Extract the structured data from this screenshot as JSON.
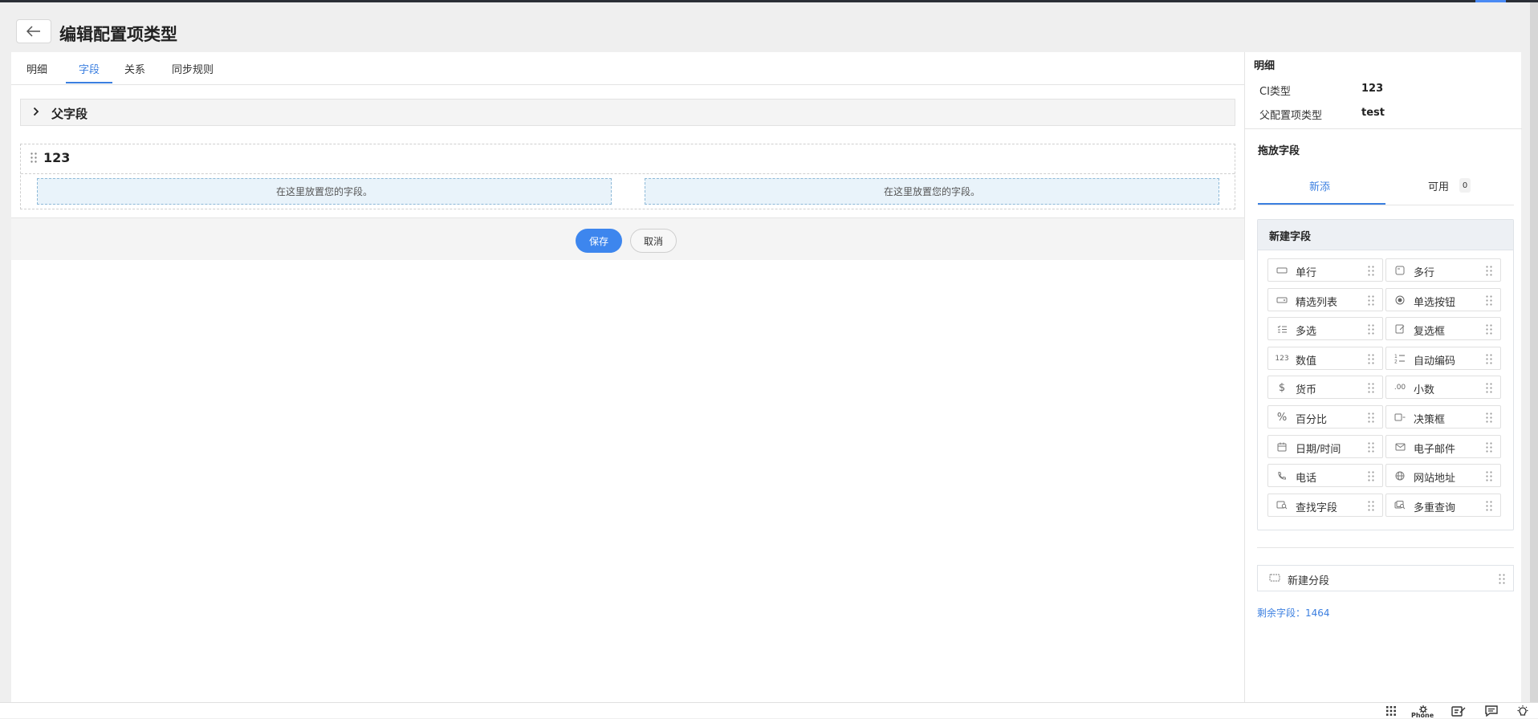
{
  "header": {
    "title": "编辑配置项类型"
  },
  "tabs": [
    {
      "label": "明细"
    },
    {
      "label": "字段"
    },
    {
      "label": "关系"
    },
    {
      "label": "同步规则"
    }
  ],
  "editor": {
    "parent_section_label": "父字段",
    "section_name": "123",
    "dropzone_text": "在这里放置您的字段。",
    "save_label": "保存",
    "cancel_label": "取消"
  },
  "sidebar": {
    "title": "明细",
    "details": [
      {
        "label": "CI类型",
        "value": "123"
      },
      {
        "label": "父配置项类型",
        "value": "test"
      }
    ],
    "drag_title": "拖放字段",
    "tabs": [
      {
        "label": "新添"
      },
      {
        "label": "可用",
        "count": "0"
      }
    ],
    "palette_title": "新建字段",
    "fields": [
      {
        "label": "单行",
        "icon": "single-line-icon"
      },
      {
        "label": "多行",
        "icon": "multi-line-icon"
      },
      {
        "label": "精选列表",
        "icon": "picklist-icon"
      },
      {
        "label": "单选按钮",
        "icon": "radio-icon"
      },
      {
        "label": "多选",
        "icon": "multi-select-icon"
      },
      {
        "label": "复选框",
        "icon": "checkbox-icon"
      },
      {
        "label": "数值",
        "icon": "number-icon"
      },
      {
        "label": "自动编码",
        "icon": "auto-number-icon"
      },
      {
        "label": "货币",
        "icon": "currency-icon"
      },
      {
        "label": "小数",
        "icon": "decimal-icon"
      },
      {
        "label": "百分比",
        "icon": "percent-icon"
      },
      {
        "label": "决策框",
        "icon": "decision-box-icon"
      },
      {
        "label": "日期/时间",
        "icon": "calendar-icon"
      },
      {
        "label": "电子邮件",
        "icon": "mail-icon"
      },
      {
        "label": "电话",
        "icon": "phone-icon"
      },
      {
        "label": "网站地址",
        "icon": "globe-icon"
      },
      {
        "label": "查找字段",
        "icon": "lookup-icon"
      },
      {
        "label": "多重查询",
        "icon": "multi-lookup-icon"
      }
    ],
    "icon_glyphs": {
      "number": "123",
      "currency": "$",
      "decimal": ".00",
      "percent": "%"
    },
    "new_segment_label": "新建分段",
    "remaining_fields": "剩余字段：1464"
  },
  "bottombar": {
    "phone_label": "Phone"
  },
  "colors": {
    "accent": "#3b7fe0",
    "save_button": "#3d86ee",
    "dropzone_bg": "#e9f3fa"
  }
}
